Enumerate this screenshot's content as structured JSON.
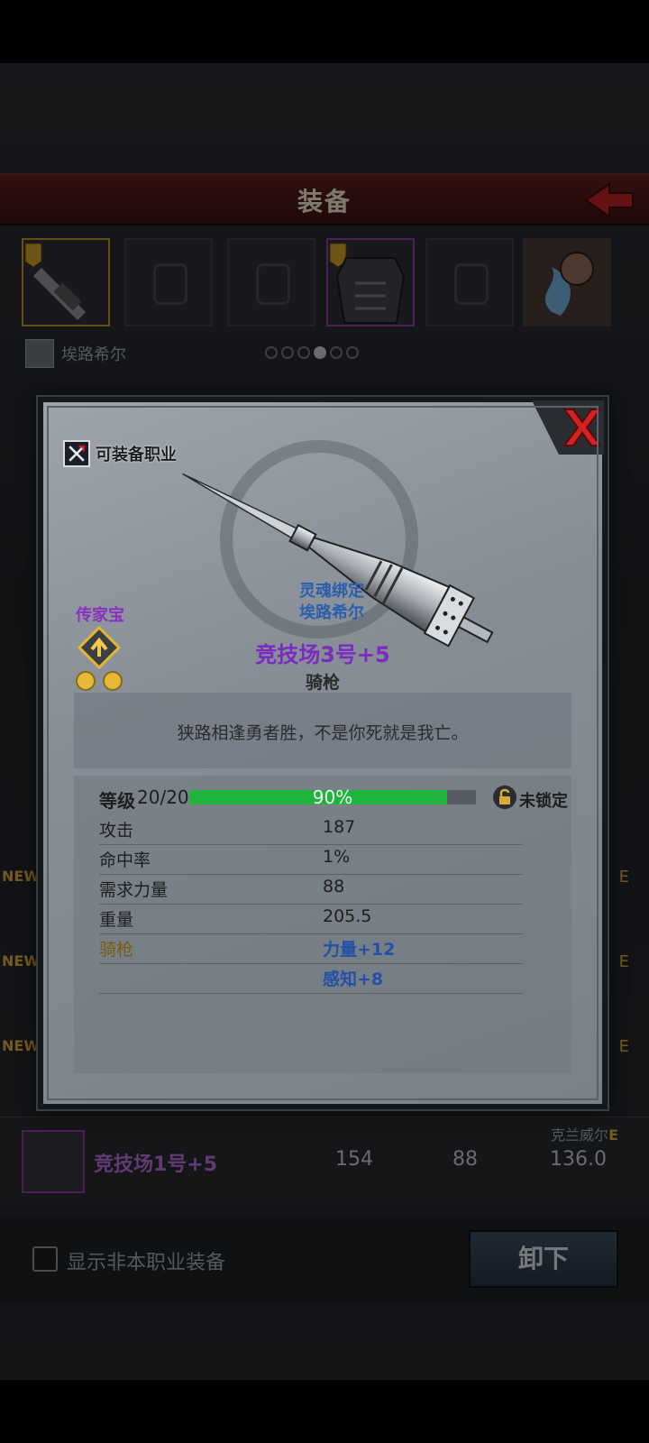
{
  "header": {
    "title": "装备"
  },
  "owner": {
    "name": "埃路希尔"
  },
  "list_item": {
    "name": "竞技场1号+5",
    "values": [
      "154",
      "88",
      "136.0"
    ],
    "owner": "克兰威尔",
    "owner_grade": "E"
  },
  "list_tags": {
    "new": "NEW",
    "grade": "E"
  },
  "bottom": {
    "checkbox_label": "显示非本职业装备",
    "unequip_label": "卸下"
  },
  "modal": {
    "class_badge": "可装备职业",
    "heirloom": "传家宝",
    "soulbound_line1": "灵魂绑定",
    "soulbound_line2": "埃路希尔",
    "item_name": "竞技场3号+5",
    "item_type": "骑枪",
    "quote": "狭路相逢勇者胜，不是你死就是我亡。",
    "level_label": "等级",
    "level_value": "20/20",
    "progress_text": "90%",
    "progress_fraction": 0.9,
    "lock_label": "未锁定",
    "stats": [
      {
        "key": "攻击",
        "value": "187"
      },
      {
        "key": "命中率",
        "value": "1%"
      },
      {
        "key": "需求力量",
        "value": "88"
      },
      {
        "key": "重量",
        "value": "205.5"
      }
    ],
    "bonus_label": "骑枪",
    "bonuses": [
      "力量+12",
      "感知+8"
    ]
  },
  "colors": {
    "accent_red": "#c0281e",
    "legendary_purple": "#7b2bc0",
    "progress_green": "#1fb43c",
    "gold": "#d8a234"
  }
}
